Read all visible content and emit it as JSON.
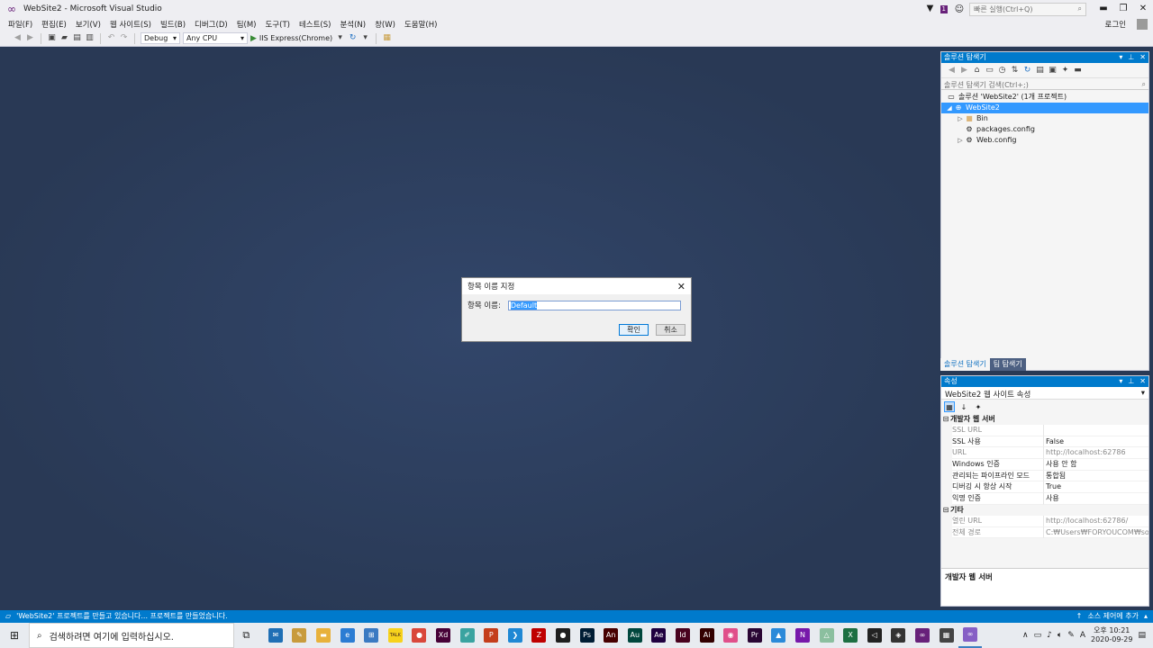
{
  "window": {
    "title": "WebSite2 - Microsoft Visual Studio",
    "quick_launch_placeholder": "빠른 실행(Ctrl+Q)",
    "notification_count": "1",
    "minimize": "▬",
    "maximize": "❐",
    "close": "✕"
  },
  "menu": {
    "items": [
      "파일(F)",
      "편집(E)",
      "보기(V)",
      "웹 사이트(S)",
      "빌드(B)",
      "디버그(D)",
      "팀(M)",
      "도구(T)",
      "테스트(S)",
      "분석(N)",
      "창(W)",
      "도움말(H)"
    ],
    "sign_in": "로그인"
  },
  "toolbar": {
    "config": "Debug",
    "platform": "Any CPU",
    "run_target": "IIS Express(Chrome)"
  },
  "solution_explorer": {
    "title": "솔루션 탐색기",
    "search_placeholder": "솔루션 탐색기 검색(Ctrl+;)",
    "tree": {
      "solution": "솔루션 'WebSite2' (1개 프로젝트)",
      "project": "WebSite2",
      "bin": "Bin",
      "packages": "packages.config",
      "webconfig": "Web.config"
    },
    "tabs": [
      "솔루션 탐색기",
      "팀 탐색기"
    ]
  },
  "properties": {
    "title": "속성",
    "object": "WebSite2 웹 사이트 속성",
    "categories": {
      "dev": "개발자 웹 서버",
      "misc": "기타"
    },
    "rows_dev": [
      {
        "name": "SSL URL",
        "value": ""
      },
      {
        "name": "SSL 사용",
        "value": "False"
      },
      {
        "name": "URL",
        "value": "http://localhost:62786"
      },
      {
        "name": "Windows 인증",
        "value": "사용 안 함"
      },
      {
        "name": "관리되는 파이프라인 모드",
        "value": "통합됨"
      },
      {
        "name": "디버깅 시 항상 시작",
        "value": "True"
      },
      {
        "name": "익명 인증",
        "value": "사용"
      }
    ],
    "rows_misc": [
      {
        "name": "열린 URL",
        "value": "http://localhost:62786/"
      },
      {
        "name": "전체 경로",
        "value": "C:₩Users₩FORYOUCOM₩source"
      }
    ],
    "description": "개발자 웹 서버"
  },
  "dialog": {
    "title": "항목 이름 지정",
    "label": "항목 이름:",
    "value": "Default",
    "ok": "확인",
    "cancel": "취소"
  },
  "status": {
    "message": "'WebSite2' 프로젝트를 만들고 있습니다... 프로젝트를 만들었습니다.",
    "source_control": "소스 제어에 추가"
  },
  "taskbar": {
    "search_placeholder": "검색하려면 여기에 입력하십시오.",
    "time": "오후 10:21",
    "date": "2020-09-29",
    "ime": "A",
    "apps": [
      {
        "name": "mail-app-icon",
        "label": "✉",
        "color": "#1f6fb5"
      },
      {
        "name": "paint-app-icon",
        "label": "✎",
        "color": "#c89b3c"
      },
      {
        "name": "explorer-app-icon",
        "label": "▬",
        "color": "#e8b13b"
      },
      {
        "name": "edge-app-icon",
        "label": "e",
        "color": "#2b7cd3"
      },
      {
        "name": "store-app-icon",
        "label": "⊞",
        "color": "#3b7ac2"
      },
      {
        "name": "kakaotalk-app-icon",
        "label": "TALK",
        "color": "#f7d21c"
      },
      {
        "name": "chrome-app-icon",
        "label": "●",
        "color": "#d9473b"
      },
      {
        "name": "xd-app-icon",
        "label": "Xd",
        "color": "#470137"
      },
      {
        "name": "notes-app-icon",
        "label": "✐",
        "color": "#3aa3a0"
      },
      {
        "name": "powerpoint-app-icon",
        "label": "P",
        "color": "#c43e1c"
      },
      {
        "name": "vscode-app-icon",
        "label": "❯",
        "color": "#1f88d4"
      },
      {
        "name": "filezilla-app-icon",
        "label": "Z",
        "color": "#bf0000"
      },
      {
        "name": "record-app-icon",
        "label": "●",
        "color": "#1e1e1e"
      },
      {
        "name": "photoshop-app-icon",
        "label": "Ps",
        "color": "#001d34"
      },
      {
        "name": "animate-app-icon",
        "label": "An",
        "color": "#470000"
      },
      {
        "name": "audition-app-icon",
        "label": "Au",
        "color": "#00473d"
      },
      {
        "name": "aftereffects-app-icon",
        "label": "Ae",
        "color": "#1f0040"
      },
      {
        "name": "indesign-app-icon",
        "label": "Id",
        "color": "#49021f"
      },
      {
        "name": "illustrator-app-icon",
        "label": "Ai",
        "color": "#330000"
      },
      {
        "name": "media-app-icon",
        "label": "◉",
        "color": "#e04f8a"
      },
      {
        "name": "premiere-app-icon",
        "label": "Pr",
        "color": "#2a0634"
      },
      {
        "name": "azure-app-icon",
        "label": "▲",
        "color": "#2b8ad9"
      },
      {
        "name": "onenote-app-icon",
        "label": "N",
        "color": "#7719aa"
      },
      {
        "name": "triangle-app-icon",
        "label": "△",
        "color": "#8bbf9f"
      },
      {
        "name": "excel-app-icon",
        "label": "X",
        "color": "#1d6f42"
      },
      {
        "name": "unity-app-icon",
        "label": "◁",
        "color": "#222222"
      },
      {
        "name": "unity2-app-icon",
        "label": "◈",
        "color": "#333333"
      },
      {
        "name": "vs-purple-app-icon",
        "label": "∞",
        "color": "#68217a"
      },
      {
        "name": "calculator-app-icon",
        "label": "▦",
        "color": "#444444"
      },
      {
        "name": "visualstudio-app-icon",
        "label": "∞",
        "color": "#865fc5"
      }
    ]
  },
  "colors": {
    "accent": "#007acc",
    "editor_bg": "#293955",
    "selection": "#3399ff",
    "vs_purple": "#68217a"
  }
}
